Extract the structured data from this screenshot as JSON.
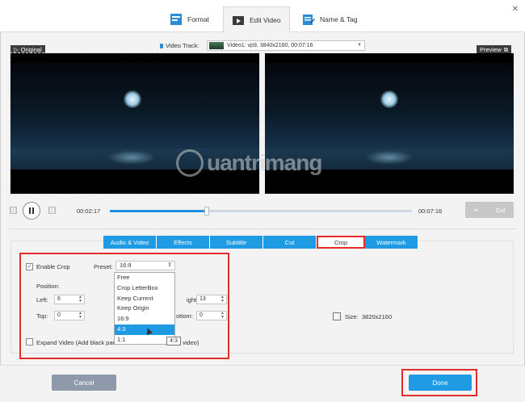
{
  "tabs": [
    {
      "label": "Format",
      "icon": "format-icon"
    },
    {
      "label": "Edit Video",
      "icon": "edit-video-icon"
    },
    {
      "label": "Name & Tag",
      "icon": "name-tag-icon"
    }
  ],
  "track": {
    "label": "Video Track:",
    "value": "Video1: vp9, 3840x2160, 00:07:16"
  },
  "panes": {
    "original": "Original",
    "preview": "Preview"
  },
  "watermark": "uantrimang",
  "playback": {
    "current": "00:02:17",
    "total": "00:07:16",
    "progress": 0.32,
    "cut_label": "Cut"
  },
  "edit_tabs": [
    "Audio & Video",
    "Effects",
    "Subtitle",
    "Cut",
    "Crop",
    "Watermark"
  ],
  "active_edit_tab": "Crop",
  "crop": {
    "enable_label": "Enable Crop",
    "enable_checked": "✓",
    "preset_label": "Preset:",
    "preset_value": "16:9",
    "position_label": "Position:",
    "left_label": "Left:",
    "left_value": "6",
    "right_label": "ight:",
    "right_value": "13",
    "top_label": "Top:",
    "top_value": "0",
    "bottom_label": "ottom:",
    "bottom_value": "0",
    "size_label": "Size:",
    "size_value": "3820x2160",
    "expand_label": "Expand Video (Add black pad",
    "expand_tail": "video)",
    "dropdown": [
      "Free",
      "Crop LetterBox",
      "Keep Current",
      "Keep Origin",
      "16:9",
      "4:3",
      "1:1"
    ],
    "selected_option": "4:3",
    "tooltip": "4:3"
  },
  "footer": {
    "cancel": "Cancel",
    "done": "Done"
  },
  "colors": {
    "accent": "#1e9be3",
    "highlight": "#e62b2b",
    "cancel": "#8e9aab"
  }
}
